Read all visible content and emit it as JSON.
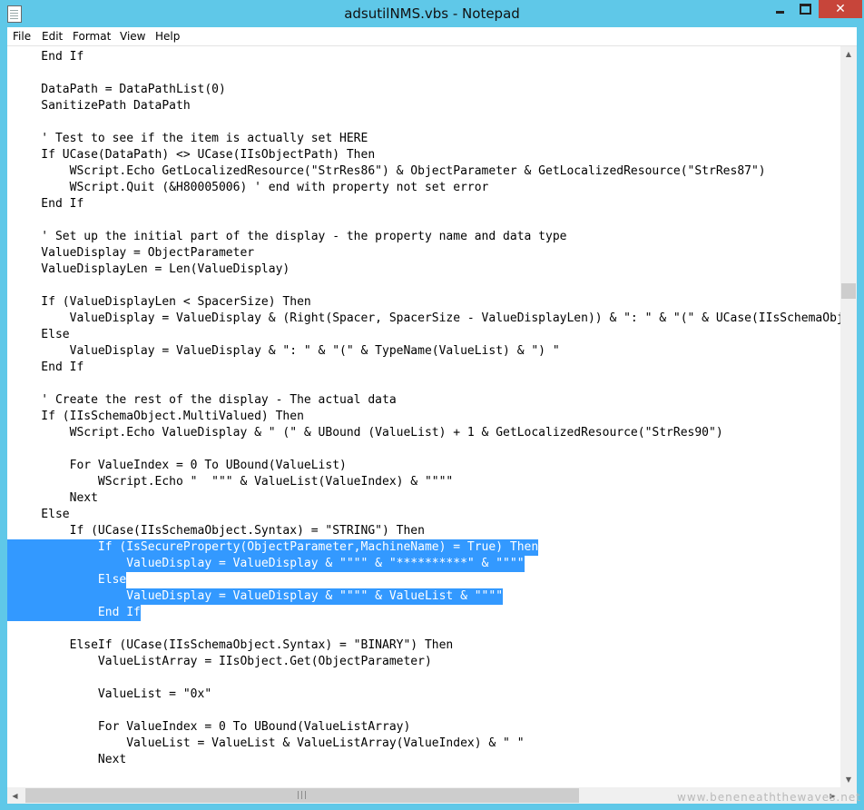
{
  "window": {
    "title": "adsutilNMS.vbs - Notepad",
    "minimize_label": "–",
    "close_label": "✕"
  },
  "menu": [
    "File",
    "Edit",
    "Format",
    "View",
    "Help"
  ],
  "code_lines": [
    {
      "text": "    End If",
      "hl": ""
    },
    {
      "text": "",
      "hl": ""
    },
    {
      "text": "    DataPath = DataPathList(0)",
      "hl": ""
    },
    {
      "text": "    SanitizePath DataPath",
      "hl": ""
    },
    {
      "text": "",
      "hl": ""
    },
    {
      "text": "    ' Test to see if the item is actually set HERE",
      "hl": ""
    },
    {
      "text": "    If UCase(DataPath) <> UCase(IIsObjectPath) Then",
      "hl": ""
    },
    {
      "text": "        WScript.Echo GetLocalizedResource(\"StrRes86\") & ObjectParameter & GetLocalizedResource(\"StrRes87\")",
      "hl": ""
    },
    {
      "text": "        WScript.Quit (&H80005006) ' end with property not set error",
      "hl": ""
    },
    {
      "text": "    End If",
      "hl": ""
    },
    {
      "text": "",
      "hl": ""
    },
    {
      "text": "    ' Set up the initial part of the display - the property name and data type",
      "hl": ""
    },
    {
      "text": "    ValueDisplay = ObjectParameter",
      "hl": ""
    },
    {
      "text": "    ValueDisplayLen = Len(ValueDisplay)",
      "hl": ""
    },
    {
      "text": "",
      "hl": ""
    },
    {
      "text": "    If (ValueDisplayLen < SpacerSize) Then",
      "hl": ""
    },
    {
      "text": "        ValueDisplay = ValueDisplay & (Right(Spacer, SpacerSize - ValueDisplayLen)) & \": \" & \"(\" & UCase(IIsSchemaObject.Syntax) & \") \"",
      "hl": ""
    },
    {
      "text": "    Else",
      "hl": ""
    },
    {
      "text": "        ValueDisplay = ValueDisplay & \": \" & \"(\" & TypeName(ValueList) & \") \"",
      "hl": ""
    },
    {
      "text": "    End If",
      "hl": ""
    },
    {
      "text": "",
      "hl": ""
    },
    {
      "text": "    ' Create the rest of the display - The actual data",
      "hl": ""
    },
    {
      "text": "    If (IIsSchemaObject.MultiValued) Then",
      "hl": ""
    },
    {
      "text": "        WScript.Echo ValueDisplay & \" (\" & UBound (ValueList) + 1 & GetLocalizedResource(\"StrRes90\")",
      "hl": ""
    },
    {
      "text": "",
      "hl": ""
    },
    {
      "text": "        For ValueIndex = 0 To UBound(ValueList)",
      "hl": ""
    },
    {
      "text": "            WScript.Echo \"  \"\"\" & ValueList(ValueIndex) & \"\"\"\"",
      "hl": ""
    },
    {
      "text": "        Next",
      "hl": ""
    },
    {
      "text": "    Else",
      "hl": ""
    },
    {
      "text": "        If (UCase(IIsSchemaObject.Syntax) = \"STRING\") Then",
      "hl": "partial"
    },
    {
      "text": "            If (IsSecureProperty(ObjectParameter,MachineName) = True) Then",
      "hl": "full"
    },
    {
      "text": "                ValueDisplay = ValueDisplay & \"\"\"\" & \"**********\" & \"\"\"\"",
      "hl": "full"
    },
    {
      "text": "            Else",
      "hl": "full"
    },
    {
      "text": "                ValueDisplay = ValueDisplay & \"\"\"\" & ValueList & \"\"\"\"",
      "hl": "full"
    },
    {
      "text": "            End If",
      "hl": "full"
    },
    {
      "text": "",
      "hl": ""
    },
    {
      "text": "        ElseIf (UCase(IIsSchemaObject.Syntax) = \"BINARY\") Then",
      "hl": ""
    },
    {
      "text": "            ValueListArray = IIsObject.Get(ObjectParameter)",
      "hl": ""
    },
    {
      "text": "",
      "hl": ""
    },
    {
      "text": "            ValueList = \"0x\"",
      "hl": ""
    },
    {
      "text": "",
      "hl": ""
    },
    {
      "text": "            For ValueIndex = 0 To UBound(ValueListArray)",
      "hl": ""
    },
    {
      "text": "                ValueList = ValueList & ValueListArray(ValueIndex) & \" \"",
      "hl": ""
    },
    {
      "text": "            Next",
      "hl": ""
    }
  ],
  "watermark": "www.beneneaththewaves.net",
  "scrollbar_grip": "|||"
}
